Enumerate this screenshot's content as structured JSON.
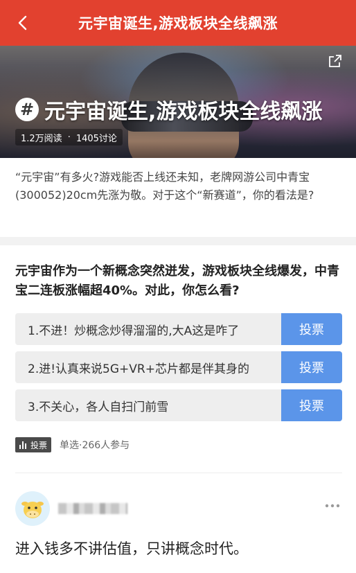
{
  "topbar": {
    "title": "元宇宙诞生,游戏板块全线飙涨"
  },
  "hero": {
    "title": "元宇宙诞生,游戏板块全线飙涨",
    "hash_symbol": "#",
    "reads": "1.2万阅读",
    "separator": "·",
    "discussions": "1405讨论"
  },
  "description": "“元宇宙”有多火?游戏能否上线还未知，老牌网游公司中青宝(300052)20cm先涨为敬。对于这个“新赛道”，你的看法是?",
  "poll": {
    "question": "元宇宙作为一个新概念突然迸发，游戏板块全线爆发，中青宝二连板涨幅超40%。对此，你怎么看?",
    "options": [
      {
        "label": "1.不进！炒概念炒得溜溜的,大A这是咋了",
        "button": "投票"
      },
      {
        "label": "2.进!认真来说5G+VR+芯片都是伴其身的",
        "button": "投票"
      },
      {
        "label": "3.不关心，各人自扫门前雪",
        "button": "投票"
      }
    ],
    "tag": "投票",
    "meta": "单选·266人参与"
  },
  "comment": {
    "text": "进入钱多不讲估值，只讲概念时代。"
  },
  "colors": {
    "topbar": "#e2412f",
    "vote_button": "#5b95e9"
  },
  "icons": [
    "back-icon",
    "share-icon",
    "hash-icon",
    "bar-chart-icon",
    "avatar-cow-icon",
    "more-icon"
  ]
}
